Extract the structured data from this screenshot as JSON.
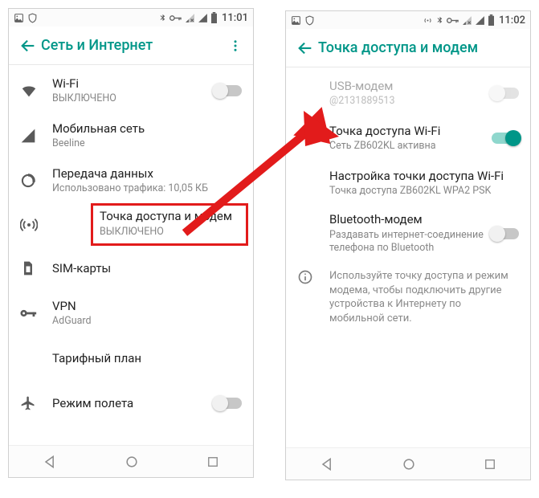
{
  "statusbar": {
    "time_left": "11:01",
    "time_right": "11:02"
  },
  "left": {
    "title": "Сеть и Интернет",
    "items": [
      {
        "title": "Wi-Fi",
        "sub": "ВЫКЛЮЧЕНО"
      },
      {
        "title": "Мобильная сеть",
        "sub": "Beeline"
      },
      {
        "title": "Передача данных",
        "sub": "Использовано трафика: 10,05 КБ"
      },
      {
        "title": "Точка доступа и модем",
        "sub": "ВЫКЛЮЧЕНО"
      },
      {
        "title": "SIM-карты"
      },
      {
        "title": "VPN",
        "sub": "AdGuard"
      },
      {
        "title": "Тарифный план"
      },
      {
        "title": "Режим полета"
      }
    ]
  },
  "right": {
    "title": "Точка доступа и модем",
    "items": [
      {
        "title": "USB-модем",
        "sub": "@2131889513"
      },
      {
        "title": "Точка доступа Wi-Fi",
        "sub": "Сеть ZB602KL активна"
      },
      {
        "title": "Настройка точки доступа Wi-Fi",
        "sub": "Точка доступа ZB602KL WPA2 PSK"
      },
      {
        "title": "Bluetooth-модем",
        "sub": "Раздавать интернет-соединение телефона по Bluetooth"
      }
    ],
    "note": "Используйте точку доступа и режим модема, чтобы подключить другие устройства к Интернету по мобильной сети."
  }
}
